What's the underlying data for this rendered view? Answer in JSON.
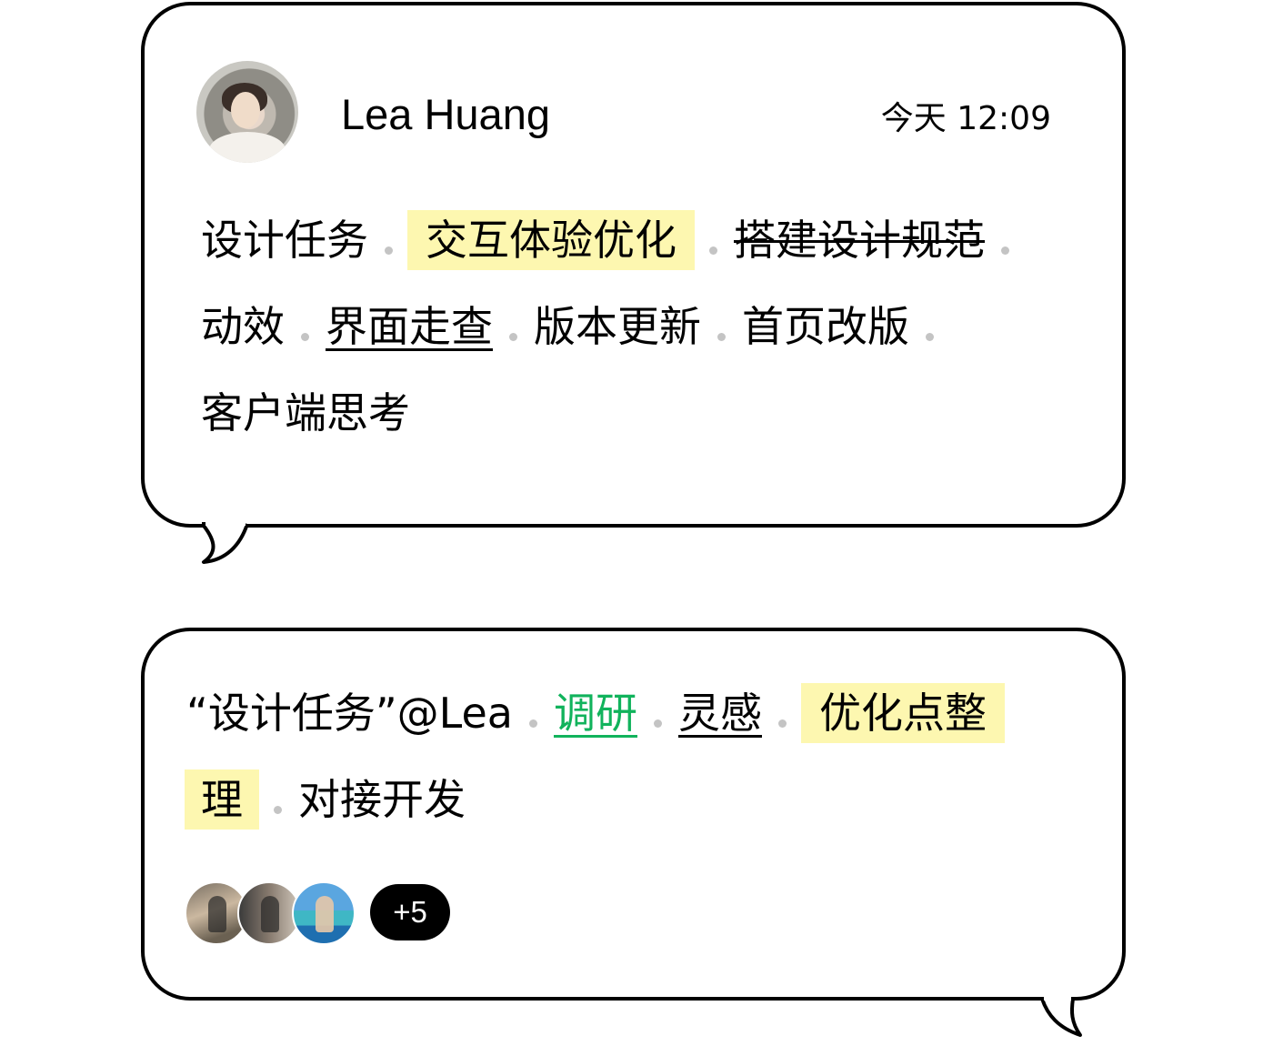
{
  "message1": {
    "user_name": "Lea Huang",
    "timestamp": "今天 12:09",
    "tags": [
      {
        "text": "设计任务"
      },
      {
        "text": "交互体验优化",
        "style": "highlight"
      },
      {
        "text": "搭建设计规范",
        "style": "strikethrough"
      },
      {
        "text": "动效"
      },
      {
        "text": "界面走查",
        "style": "underline"
      },
      {
        "text": "版本更新"
      },
      {
        "text": "首页改版"
      },
      {
        "text": "客户端思考"
      }
    ]
  },
  "message2": {
    "tags": [
      {
        "text": "“设计任务”@Lea"
      },
      {
        "text": "调研",
        "style": "underline-green"
      },
      {
        "text": "灵感",
        "style": "underline"
      },
      {
        "text": "优化点整",
        "style": "highlight"
      },
      {
        "text": "理",
        "style": "highlight"
      },
      {
        "text": "对接开发"
      }
    ],
    "participants_more": "+5"
  },
  "colors": {
    "highlight": "#fdf7b0",
    "accent_green": "#11b35c",
    "separator": "#c4c4c4"
  }
}
